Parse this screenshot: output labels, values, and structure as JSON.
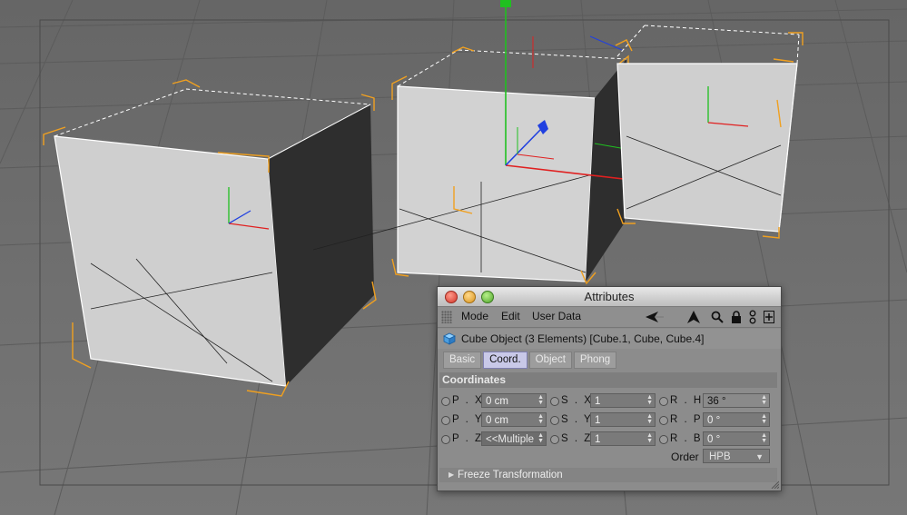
{
  "window": {
    "title": "Attributes"
  },
  "menu": {
    "items": [
      "Mode",
      "Edit",
      "User Data"
    ]
  },
  "toolbar_icons": [
    "back-arrow-icon",
    "up-arrow-icon",
    "search-icon",
    "lock-icon",
    "link-icon",
    "new-panel-icon"
  ],
  "object": {
    "label": "Cube Object (3 Elements) [Cube.1, Cube, Cube.4]",
    "icon": "cube-object-icon"
  },
  "tabs": [
    {
      "label": "Basic",
      "active": false
    },
    {
      "label": "Coord.",
      "active": true
    },
    {
      "label": "Object",
      "active": false
    },
    {
      "label": "Phong",
      "active": false
    }
  ],
  "section": {
    "title": "Coordinates"
  },
  "coords": {
    "position": [
      {
        "label": "P . X",
        "value": "0 cm"
      },
      {
        "label": "P . Y",
        "value": "0 cm"
      },
      {
        "label": "P . Z",
        "value": "<<Multiple"
      }
    ],
    "scale": [
      {
        "label": "S . X",
        "value": "1"
      },
      {
        "label": "S . Y",
        "value": "1"
      },
      {
        "label": "S . Z",
        "value": "1"
      }
    ],
    "rotation": [
      {
        "label": "R . H",
        "value": "36 °"
      },
      {
        "label": "R . P",
        "value": "0 °"
      },
      {
        "label": "R . B",
        "value": "0 °"
      }
    ]
  },
  "order": {
    "label": "Order",
    "value": "HPB"
  },
  "freeze": {
    "label": "Freeze Transformation"
  },
  "colors": {
    "viewport_bg": "#6e6e6e",
    "cube_face": "#cfcfcf",
    "cube_side": "#2e2e2e",
    "selection_orange": "#f0a020",
    "axis_x": "#e02020",
    "axis_y": "#20c020",
    "axis_z": "#2040e0",
    "active_tab": "#c9c9e8"
  }
}
